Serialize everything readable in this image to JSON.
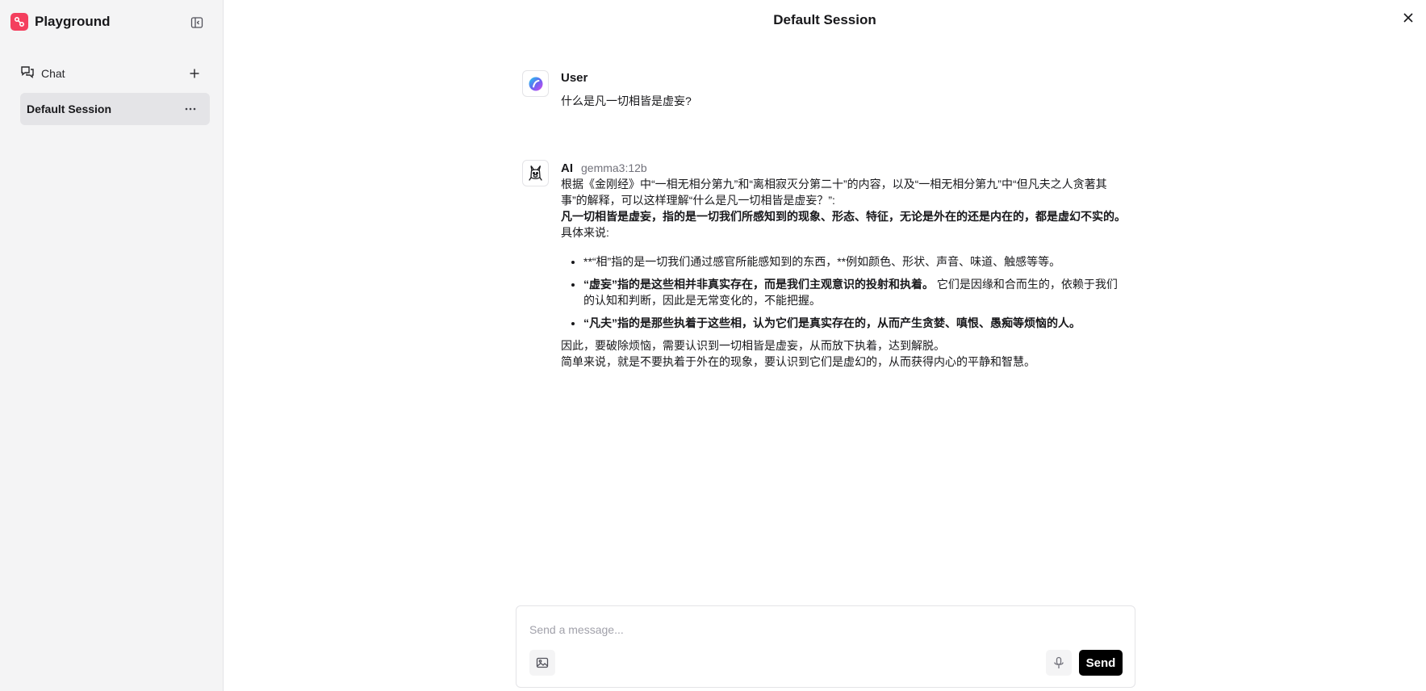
{
  "app": {
    "title": "Playground",
    "brand_color": "#f43f5e"
  },
  "sidebar": {
    "nav_chat_label": "Chat",
    "sessions": [
      {
        "label": "Default Session",
        "selected": true
      }
    ],
    "icons": {
      "toggle": "sidebar-toggle-icon",
      "chat": "chat-bubbles-icon",
      "add": "plus-icon",
      "more": "ellipsis-icon"
    }
  },
  "main": {
    "title": "Default Session",
    "messages": [
      {
        "role": "User",
        "text": "什么是凡一切相皆是虚妄?"
      },
      {
        "role": "AI",
        "model": "gemma3:12b",
        "intro": "根据《金刚经》中“一相无相分第九”和“离相寂灭分第二十”的内容，以及“一相无相分第九”中“但凡夫之人贪著其事”的解释，可以这样理解“什么是凡一切相皆是虚妄？”:",
        "summary_bold": "凡一切相皆是虚妄，指的是一切我们所感知到的现象、形态、特征，无论是外在的还是内在的，都是虚幻不实的。",
        "summary_lead": "具体来说:",
        "bullets": [
          {
            "bold": "",
            "text": "**“相”指的是一切我们通过感官所能感知到的东西，**例如颜色、形状、声音、味道、触感等等。"
          },
          {
            "bold": "“虚妄”指的是这些相并非真实存在，而是我们主观意识的投射和执着。",
            "text": " 它们是因缘和合而生的，依赖于我们的认知和判断，因此是无常变化的，不能把握。"
          },
          {
            "bold": "“凡夫”指的是那些执着于这些相，认为它们是真实存在的，从而产生贪婪、嗔恨、愚痴等烦恼的人。",
            "text": ""
          }
        ],
        "conclusion": "因此，要破除烦恼，需要认识到一切相皆是虚妄，从而放下执着，达到解脱。",
        "final": "简单来说，就是不要执着于外在的现象，要认识到它们是虚幻的，从而获得内心的平静和智慧。"
      }
    ]
  },
  "composer": {
    "placeholder": "Send a message...",
    "send_label": "Send"
  }
}
